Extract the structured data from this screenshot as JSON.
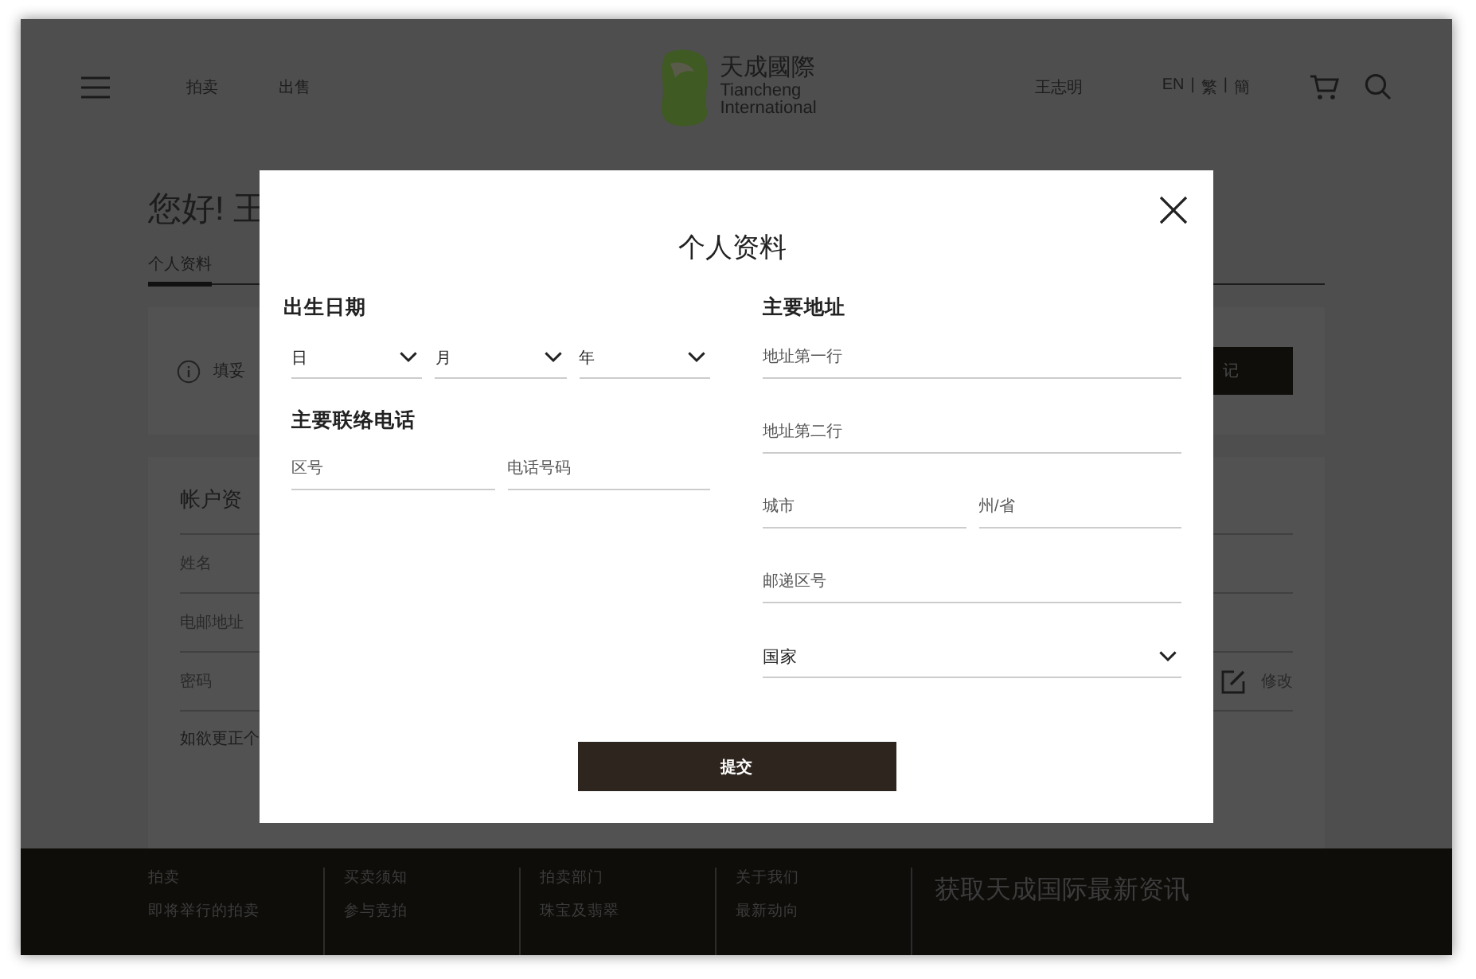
{
  "header": {
    "nav": [
      "拍卖",
      "出售"
    ],
    "logo": {
      "name_cn": "天成國際",
      "name_en_1": "Tiancheng",
      "name_en_2": "International"
    },
    "user": "王志明",
    "languages": [
      "EN",
      "繁",
      "簡"
    ],
    "separator": "|"
  },
  "page": {
    "greeting": "您好! 王",
    "tabs": [
      {
        "label": "个人资料",
        "selected": true
      }
    ],
    "notice": "填妥",
    "notice_button": "记",
    "account": {
      "title": "帐户资",
      "rows": [
        {
          "label": "姓名"
        },
        {
          "label": "电邮地址"
        },
        {
          "label": "密码",
          "action": "修改"
        }
      ],
      "note": "如欲更正个"
    }
  },
  "modal": {
    "title": "个人资料",
    "birth_date": {
      "label": "出生日期",
      "selects": [
        "日",
        "月",
        "年"
      ]
    },
    "phone": {
      "label": "主要联络电话",
      "fields": [
        {
          "placeholder": "区号"
        },
        {
          "placeholder": "电话号码"
        }
      ]
    },
    "address": {
      "label": "主要地址",
      "rows": [
        {
          "fields": [
            {
              "kind": "input",
              "placeholder": "地址第一行"
            }
          ]
        },
        {
          "fields": [
            {
              "kind": "input",
              "placeholder": "地址第二行"
            }
          ]
        },
        {
          "fields": [
            {
              "kind": "input",
              "placeholder": "城市"
            },
            {
              "kind": "input",
              "placeholder": "州/省"
            }
          ]
        },
        {
          "fields": [
            {
              "kind": "input",
              "placeholder": "邮递区号"
            }
          ]
        },
        {
          "fields": [
            {
              "kind": "select",
              "label": "国家"
            }
          ]
        }
      ]
    },
    "submit": "提交"
  },
  "footer": {
    "columns": [
      {
        "heading": "拍卖",
        "link": "即将举行的拍卖"
      },
      {
        "heading": "买卖须知",
        "link": "参与竞拍"
      },
      {
        "heading": "拍卖部门",
        "link": "珠宝及翡翠"
      },
      {
        "heading": "关于我们",
        "link": "最新动向"
      }
    ],
    "newsletter_title": "获取天成国际最新资讯"
  }
}
